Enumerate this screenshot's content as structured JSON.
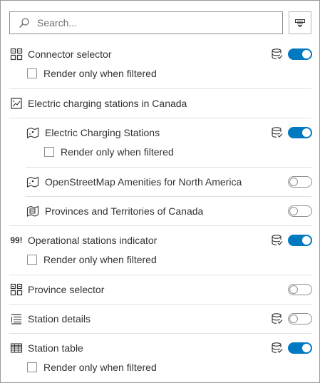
{
  "search": {
    "placeholder": "Search..."
  },
  "items": {
    "connector_selector": {
      "label": "Connector selector",
      "toggle": "on",
      "render_label": "Render only when filtered"
    },
    "group_canada": {
      "label": "Electric charging stations in Canada"
    },
    "ev_stations": {
      "label": "Electric Charging Stations",
      "toggle": "on",
      "render_label": "Render only when filtered"
    },
    "osm_amenities": {
      "label": "OpenStreetMap Amenities for North America",
      "toggle": "off"
    },
    "provinces_territories": {
      "label": "Provinces and Territories of Canada",
      "toggle": "off"
    },
    "operational_indicator": {
      "label": "Operational stations indicator",
      "icon_text": "99!",
      "toggle": "on",
      "render_label": "Render only when filtered"
    },
    "province_selector": {
      "label": "Province selector",
      "toggle": "off"
    },
    "station_details": {
      "label": "Station details",
      "toggle": "off"
    },
    "station_table": {
      "label": "Station table",
      "toggle": "on",
      "render_label": "Render only when filtered"
    }
  },
  "icons": {
    "search": "search-icon",
    "filter": "filter-list-icon",
    "selector": "category-selector-icon",
    "map_group": "map-group-icon",
    "layer": "feature-layer-icon",
    "indicator": "indicator-icon",
    "details": "details-list-icon",
    "table": "table-icon",
    "datasource": "data-source-icon"
  },
  "colors": {
    "accent": "#0079c1",
    "text": "#323232",
    "border": "#8f8f8f",
    "divider": "#e0e0e0"
  }
}
